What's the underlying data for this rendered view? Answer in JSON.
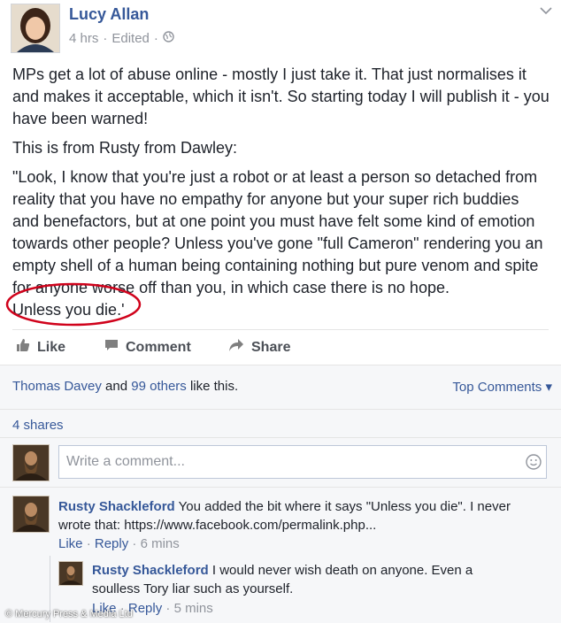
{
  "post": {
    "author": "Lucy Allan",
    "time": "4 hrs",
    "edited": "Edited",
    "paragraphs": [
      "MPs get a lot of abuse online - mostly I just take it. That just normalises it and makes it acceptable, which it isn't. So starting today I will publish it - you have been warned!",
      "This is from Rusty from Dawley:"
    ],
    "quote_lines": [
      "\"Look, I know that you're just a robot or at least a person so detached from",
      "reality that you have no empathy for anyone but your super rich buddies",
      "and benefactors, but at one point you must have felt some kind of emotion",
      "towards other people? Unless you've gone \"full Cameron\" rendering you an",
      "empty shell of a human being containing nothing but pure venom and spite",
      "for anyone worse off than you, in which case there is no hope."
    ],
    "circled_line": "Unless you die.'"
  },
  "actions": {
    "like": "Like",
    "comment": "Comment",
    "share": "Share"
  },
  "reactions": {
    "liker": "Thomas Davey",
    "and": "and",
    "others_count": "99 others",
    "suffix": "like this.",
    "sort_label": "Top Comments"
  },
  "shares": "4 shares",
  "comment_input": {
    "placeholder": "Write a comment..."
  },
  "comments": [
    {
      "author": "Rusty Shackleford",
      "text_line1": "You added the bit where it says \"Unless you die\". I never",
      "text_line2": "wrote that: https://www.facebook.com/permalink.php...",
      "like": "Like",
      "reply": "Reply",
      "time": "6 mins"
    },
    {
      "author": "Rusty Shackleford",
      "text_line1": "I would never wish death on anyone. Even a",
      "text_line2": "soulless Tory liar such as yourself.",
      "like": "Like",
      "reply": "Reply",
      "time": "5 mins"
    }
  ],
  "watermark": "© Mercury Press & Media Ltd",
  "colors": {
    "link": "#365899",
    "circle": "#d0021b",
    "meta": "#90949c"
  }
}
